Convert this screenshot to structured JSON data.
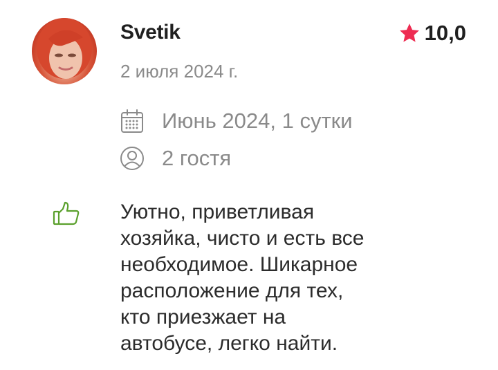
{
  "review": {
    "author": "Svetik",
    "date": "2 июля 2024 г.",
    "rating": "10,0",
    "stay_period": "Июнь 2024, 1 сутки",
    "guests": "2 гостя",
    "text_lines": [
      "Уютно, приветливая",
      "хозяйка, чисто и есть все",
      "необходимое. Шикарное",
      "расположение для тех,",
      "кто приезжает на",
      "автобусе, легко найти."
    ]
  },
  "icons": {
    "rating": "star-icon",
    "period": "calendar-icon",
    "guests": "user-icon",
    "review": "thumbs-up-icon"
  },
  "colors": {
    "star": "#ee2c52",
    "like": "#5aa02c",
    "muted_text": "#8a8a8a",
    "primary_text": "#1f1f1f"
  }
}
